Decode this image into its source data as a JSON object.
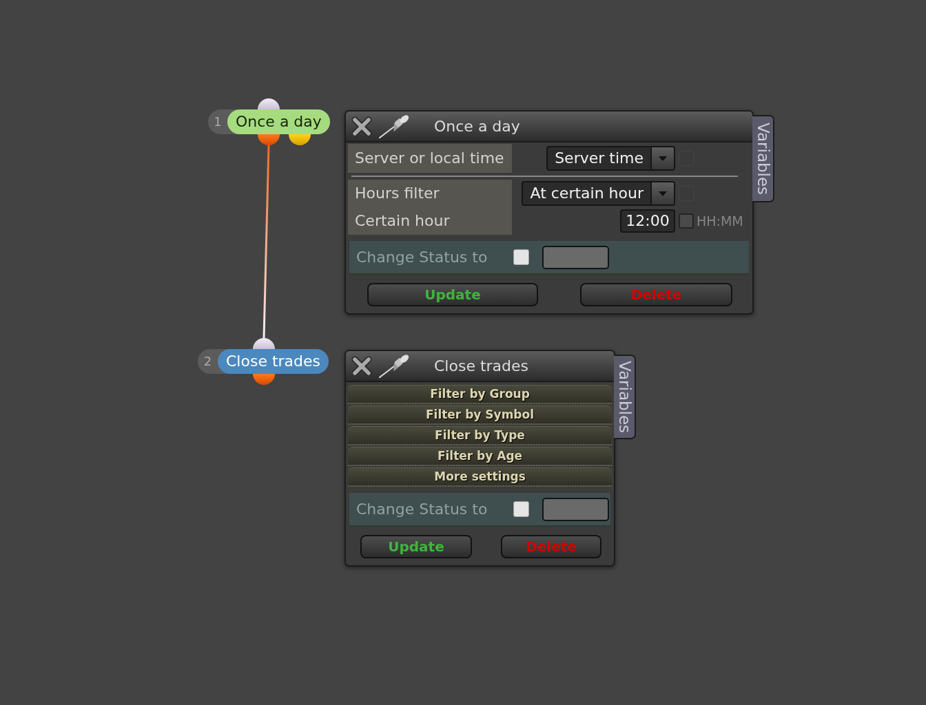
{
  "nodes": [
    {
      "number": "1",
      "label": "Once a day",
      "color": "#a6dc7f"
    },
    {
      "number": "2",
      "label": "Close trades",
      "color": "#4b88be"
    }
  ],
  "panels": [
    {
      "kind": "form",
      "title": "Once a day",
      "side_tab": "Variables",
      "field_groups": [
        [
          {
            "label": "Server or local time",
            "kind": "dropdown",
            "value": "Server time",
            "option_checkbox": {
              "checked": false,
              "disabled": true
            }
          }
        ],
        [
          {
            "label": "Hours filter",
            "kind": "dropdown",
            "value": "At certain hour",
            "option_checkbox": {
              "checked": false,
              "disabled": true
            }
          },
          {
            "label": "Certain hour",
            "kind": "text",
            "value": "12:00",
            "option_checkbox": {
              "checked": false,
              "disabled": false
            },
            "format_hint": "HH:MM"
          }
        ]
      ],
      "status": {
        "label": "Change Status to",
        "checked": false
      },
      "buttons": [
        {
          "label": "Update",
          "kind": "update"
        },
        {
          "label": "Delete",
          "kind": "delete"
        }
      ]
    },
    {
      "kind": "sections",
      "title": "Close trades",
      "side_tab": "Variables",
      "sections": [
        "Filter by Group",
        "Filter by Symbol",
        "Filter by Type",
        "Filter by Age",
        "More settings"
      ],
      "status": {
        "label": "Change Status to",
        "checked": false
      },
      "buttons": [
        {
          "label": "Update",
          "kind": "update"
        },
        {
          "label": "Delete",
          "kind": "delete"
        }
      ]
    }
  ]
}
